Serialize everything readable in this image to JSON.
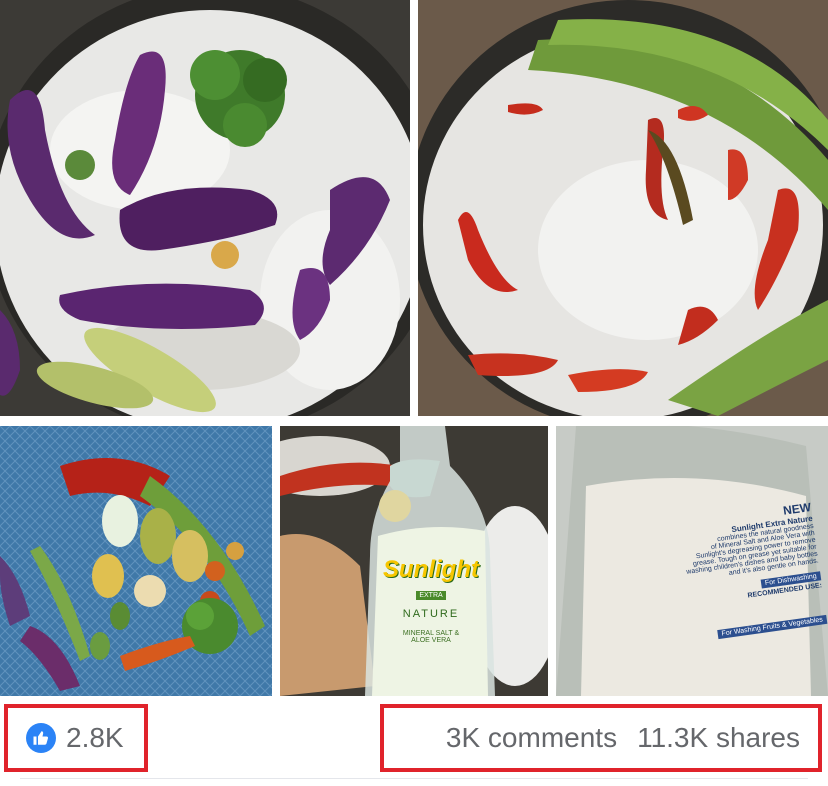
{
  "reactions": {
    "icon": "thumbs-up-icon",
    "like_color": "#2b83f6",
    "count": "2.8K"
  },
  "engagement": {
    "comments": "3K comments",
    "shares": "11.3K shares"
  },
  "photos": {
    "bottle_front": {
      "brand": "Sunlight",
      "extra": "EXTRA",
      "line": "NATURE",
      "variant_1": "MINERAL SALT &",
      "variant_2": "ALOE VERA"
    },
    "bottle_back": {
      "heading": "NEW",
      "sub_1": "Sunlight Extra Nature",
      "body_1": "combines the natural goodness",
      "body_2": "of Mineral Salt and Aloe Vera with",
      "body_3": "Sunlight's degreasing power to remove",
      "body_4": "grease. Tough on grease yet suitable for",
      "body_5": "washing children's dishes and baby bottles",
      "body_6": "and it's also gentle on hands.",
      "section_1": "For Dishwashing",
      "recommended": "RECOMMENDED USE:",
      "section_2": "For Washing Fruits & Vegetables"
    }
  },
  "highlight_color": "#e0232b"
}
